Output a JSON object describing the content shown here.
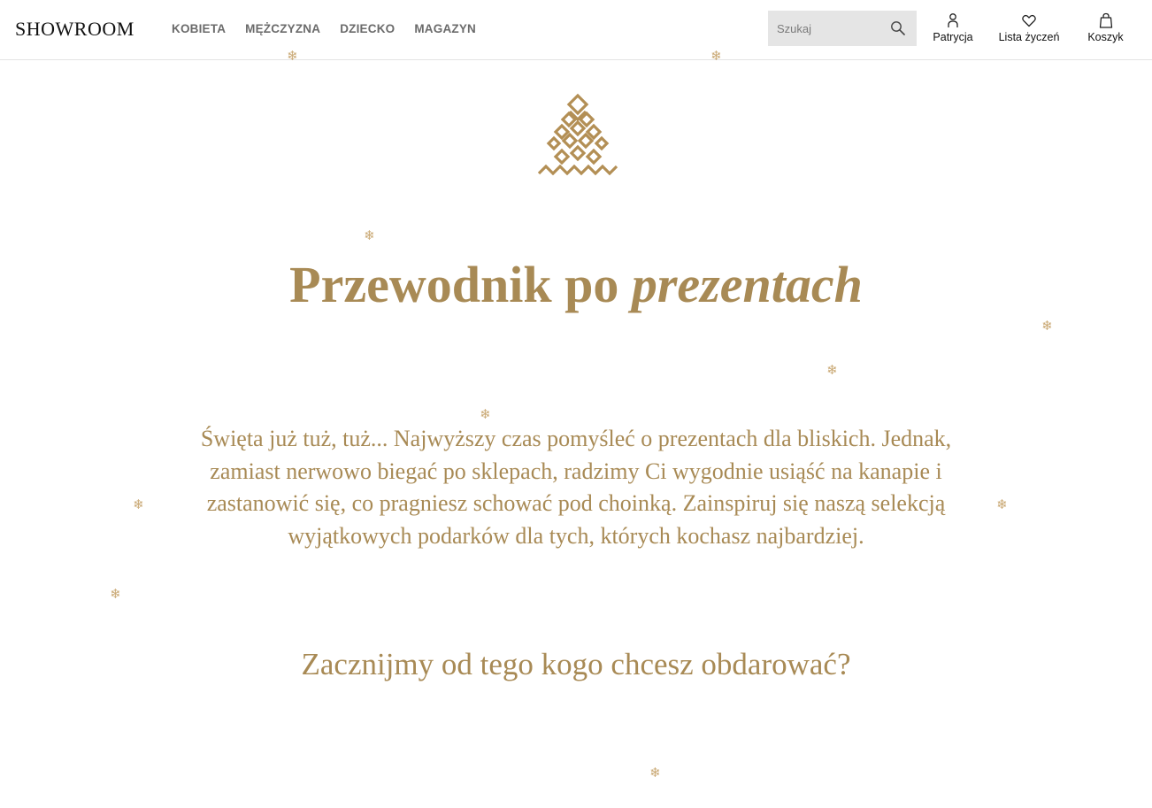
{
  "header": {
    "logo": "SHOWROOM",
    "nav": [
      {
        "label": "KOBIETA"
      },
      {
        "label": "MĘŻCZYZNA"
      },
      {
        "label": "DZIECKO"
      },
      {
        "label": "MAGAZYN"
      }
    ],
    "search": {
      "placeholder": "Szukaj",
      "value": "",
      "icon": "search-icon"
    },
    "user_tools": [
      {
        "label": "Patrycja",
        "icon": "user-icon"
      },
      {
        "label": "Lista życzeń",
        "icon": "heart-icon"
      },
      {
        "label": "Koszyk",
        "icon": "bag-icon"
      }
    ]
  },
  "main": {
    "hero_icon": "christmas-tree-icon",
    "title_regular": "Przewodnik po ",
    "title_italic": "prezentach",
    "intro": "Święta już tuż, tuż... Najwyższy czas pomyśleć o prezentach dla bliskich. Jednak, zamiast nerwowo biegać po sklepach, radzimy Ci wygodnie usiąść na kanapie i zastanowić się, co pragniesz schować pod choinką. Zainspiruj się naszą selekcją wyjątkowych podarków dla tych, których kochasz najbardziej.",
    "question": "Zacznijmy od tego kogo chcesz obdarować?"
  },
  "decor": {
    "snowflake_icon": "snowflake-icon",
    "snowflake_glyph": "❄",
    "accent_color": "#a88a55",
    "snowflake_color": "#c9a873"
  }
}
